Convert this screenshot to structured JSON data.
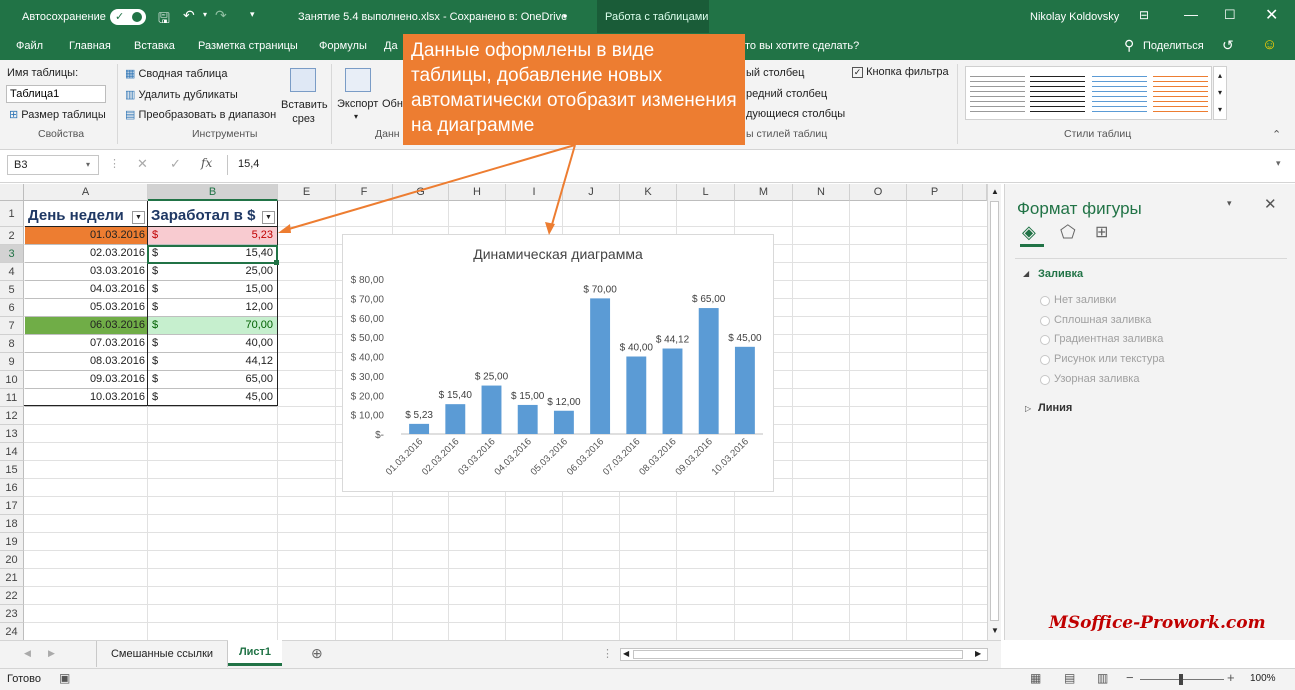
{
  "titlebar": {
    "autosave_label": "Автосохранение",
    "file_title": "Занятие 5.4 выполнено.xlsx - Сохранено в: OneDrive",
    "context_tab": "Работа с таблицами",
    "user_name": "Nikolay Koldovsky"
  },
  "menu": {
    "items": [
      "Файл",
      "Главная",
      "Вставка",
      "Разметка страницы",
      "Формулы",
      "Да"
    ],
    "tell_me": "то вы хотите сделать?",
    "share": "Поделиться"
  },
  "ribbon": {
    "table_name_label": "Имя таблицы:",
    "table_name_value": "Таблица1",
    "resize_table": "Размер таблицы",
    "group_properties": "Свойства",
    "pivot_table": "Сводная таблица",
    "remove_duplicates": "Удалить дубликаты",
    "convert_to_range": "Преобразовать в диапазон",
    "group_tools": "Инструменты",
    "insert_slicer": "Вставить срез",
    "export": "Экспорт",
    "refresh": "Обн",
    "group_external": "Данн",
    "col_option_1": "ый столбец",
    "col_option_2": "редний столбец",
    "col_option_3": "дующиеся столбцы",
    "filter_button": "Кнопка фильтра",
    "group_style_options": "ы стилей таблиц",
    "group_table_styles": "Стили таблиц"
  },
  "formula_bar": {
    "name_box": "B3",
    "fx": "fx",
    "value": "15,4"
  },
  "sheet": {
    "columns": [
      "A",
      "B",
      "E",
      "F",
      "G",
      "H",
      "I",
      "J",
      "K",
      "L",
      "M",
      "N",
      "O",
      "P"
    ],
    "row_numbers": [
      "1",
      "2",
      "3",
      "4",
      "5",
      "6",
      "7",
      "8",
      "9",
      "10",
      "11",
      "12",
      "13",
      "14",
      "15",
      "16",
      "17",
      "18",
      "19",
      "20",
      "21",
      "22",
      "23",
      "24"
    ],
    "header_a": "День недели",
    "header_b": "Заработал в $",
    "currency": "$",
    "rows": [
      {
        "date": "01.03.2016",
        "amount": "5,23"
      },
      {
        "date": "02.03.2016",
        "amount": "15,40"
      },
      {
        "date": "03.03.2016",
        "amount": "25,00"
      },
      {
        "date": "04.03.2016",
        "amount": "15,00"
      },
      {
        "date": "05.03.2016",
        "amount": "12,00"
      },
      {
        "date": "06.03.2016",
        "amount": "70,00"
      },
      {
        "date": "07.03.2016",
        "amount": "40,00"
      },
      {
        "date": "08.03.2016",
        "amount": "44,12"
      },
      {
        "date": "09.03.2016",
        "amount": "65,00"
      },
      {
        "date": "10.03.2016",
        "amount": "45,00"
      }
    ]
  },
  "callout": {
    "text": "Данные оформлены в виде таблицы, добавление новых автоматически отобразит изменения на диаграмме"
  },
  "chart_data": {
    "type": "bar",
    "title": "Динамическая диаграмма",
    "categories": [
      "01.03.2016",
      "02.03.2016",
      "03.03.2016",
      "04.03.2016",
      "05.03.2016",
      "06.03.2016",
      "07.03.2016",
      "08.03.2016",
      "09.03.2016",
      "10.03.2016"
    ],
    "values": [
      5.23,
      15.4,
      25,
      15,
      12,
      70,
      40,
      44.12,
      65,
      45
    ],
    "data_labels": [
      "$ 5,23",
      "$ 15,40",
      "$ 25,00",
      "$ 15,00",
      "$ 12,00",
      "$ 70,00",
      "$ 40,00",
      "$ 44,12",
      "$ 65,00",
      "$ 45,00"
    ],
    "y_ticks": [
      "$ 80,00",
      "$ 70,00",
      "$ 60,00",
      "$ 50,00",
      "$ 40,00",
      "$ 30,00",
      "$ 20,00",
      "$ 10,00",
      "$-"
    ],
    "ylim": [
      0,
      80
    ],
    "bar_color": "#5b9bd5",
    "grid": false
  },
  "format_pane": {
    "title": "Формат фигуры",
    "fill_section": "Заливка",
    "options": [
      "Нет заливки",
      "Сплошная заливка",
      "Градиентная заливка",
      "Рисунок или текстура",
      "Узорная заливка"
    ],
    "line_section": "Линия"
  },
  "tabs": {
    "sheet1": "Смешанные ссылки",
    "sheet2": "Лист1"
  },
  "status": {
    "ready": "Готово",
    "zoom": "100%"
  },
  "watermark": "MSoffice-Prowork.com",
  "colors": {
    "excel_green": "#217346",
    "orange_cell": "#ed7d31",
    "pink_cell": "#f8cbd0",
    "dark_green_cell": "#70ad47",
    "light_green_cell": "#c6efce"
  }
}
